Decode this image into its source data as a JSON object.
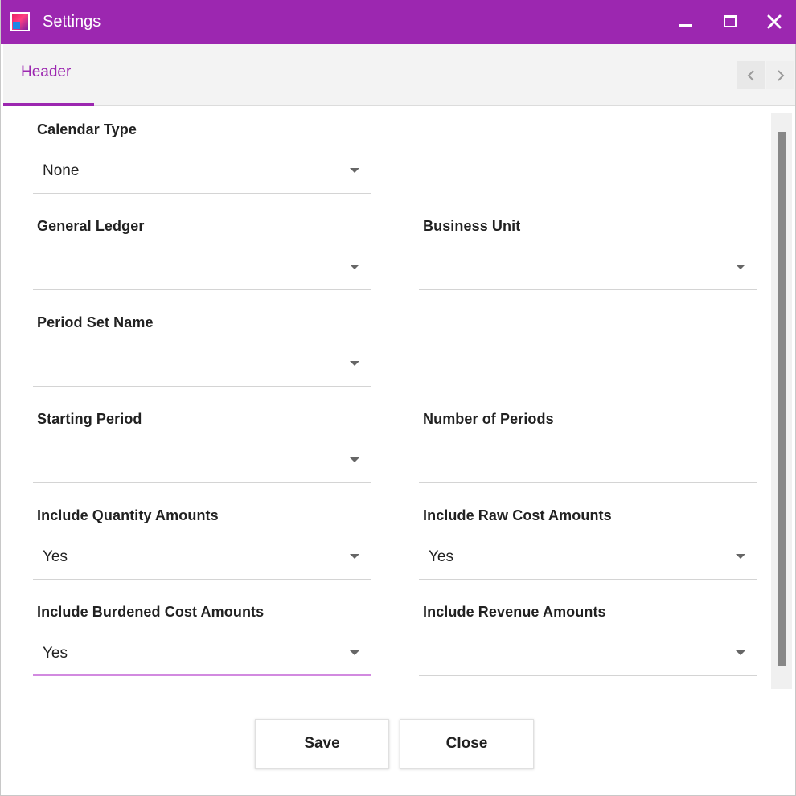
{
  "window": {
    "title": "Settings"
  },
  "icons": {
    "app": "app-logo-icon",
    "minimize": "minimize-icon",
    "maximize": "maximize-icon",
    "close": "close-icon",
    "prev": "chevron-left-icon",
    "next": "chevron-right-icon",
    "dropdown": "caret-down-icon"
  },
  "colors": {
    "accent": "#9c27b0",
    "focus_underline": "#d28ae0",
    "scrollbar_thumb": "#878787"
  },
  "tabs": [
    {
      "label": "Header",
      "active": true
    }
  ],
  "form": {
    "calendar_type": {
      "label": "Calendar Type",
      "value": "None"
    },
    "general_ledger": {
      "label": "General Ledger",
      "value": ""
    },
    "business_unit": {
      "label": "Business Unit",
      "value": ""
    },
    "period_set_name": {
      "label": "Period Set Name",
      "value": ""
    },
    "starting_period": {
      "label": "Starting Period",
      "value": ""
    },
    "number_of_periods": {
      "label": "Number of Periods",
      "value": ""
    },
    "include_quantity_amounts": {
      "label": "Include Quantity Amounts",
      "value": "Yes"
    },
    "include_raw_cost_amounts": {
      "label": "Include Raw Cost Amounts",
      "value": "Yes"
    },
    "include_burdened_cost_amounts": {
      "label": "Include Burdened Cost Amounts",
      "value": "Yes"
    },
    "include_revenue_amounts": {
      "label": "Include Revenue Amounts",
      "value": ""
    }
  },
  "footer": {
    "save_label": "Save",
    "close_label": "Close"
  }
}
